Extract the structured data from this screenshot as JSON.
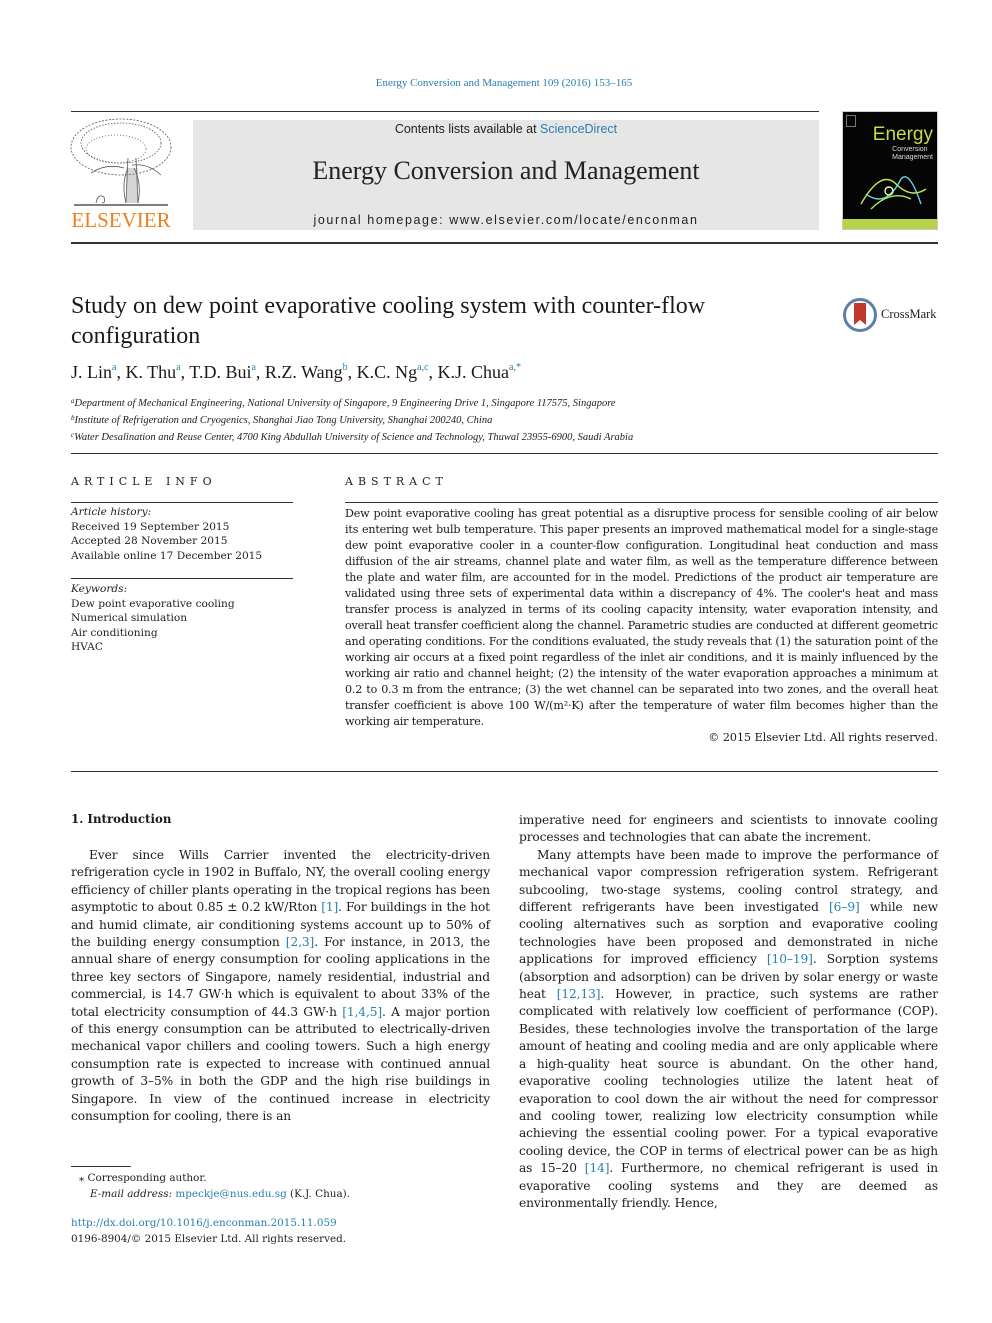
{
  "journal_ref": "Energy Conversion and Management 109 (2016) 153–165",
  "masthead": {
    "contents_prefix": "Contents lists available at ",
    "contents_link": "ScienceDirect",
    "journal_title": "Energy Conversion and Management",
    "homepage": "journal homepage: www.elsevier.com/locate/enconman"
  },
  "publisher_logo": {
    "wordmark": "ELSEVIER",
    "color": "#f07f1a"
  },
  "cover": {
    "title_large": "Energy",
    "title_line2": "Conversion",
    "title_line3": "Management",
    "accent": "#c8d94a"
  },
  "crossmark": {
    "label": "CrossMark"
  },
  "article": {
    "title": "Study on dew point evaporative cooling system with counter-flow configuration",
    "authors": [
      {
        "name": "J. Lin",
        "sup": "a"
      },
      {
        "name": "K. Thu",
        "sup": "a"
      },
      {
        "name": "T.D. Bui",
        "sup": "a"
      },
      {
        "name": "R.Z. Wang",
        "sup": "b"
      },
      {
        "name": "K.C. Ng",
        "sup": "a,c"
      },
      {
        "name": "K.J. Chua",
        "sup": "a,*"
      }
    ],
    "affiliations": [
      {
        "key": "a",
        "text": "Department of Mechanical Engineering, National University of Singapore, 9 Engineering Drive 1, Singapore 117575, Singapore"
      },
      {
        "key": "b",
        "text": "Institute of Refrigeration and Cryogenics, Shanghai Jiao Tong University, Shanghai 200240, China"
      },
      {
        "key": "c",
        "text": "Water Desalination and Reuse Center, 4700 King Abdullah University of Science and Technology, Thuwal 23955-6900, Saudi Arabia"
      }
    ]
  },
  "article_info": {
    "heading": "ARTICLE INFO",
    "history_label": "Article history:",
    "history": [
      "Received 19 September 2015",
      "Accepted 28 November 2015",
      "Available online 17 December 2015"
    ],
    "keywords_label": "Keywords:",
    "keywords": [
      "Dew point evaporative cooling",
      "Numerical simulation",
      "Air conditioning",
      "HVAC"
    ]
  },
  "abstract": {
    "heading": "ABSTRACT",
    "text": "Dew point evaporative cooling has great potential as a disruptive process for sensible cooling of air below its entering wet bulb temperature. This paper presents an improved mathematical model for a single-stage dew point evaporative cooler in a counter-flow configuration. Longitudinal heat conduction and mass diffusion of the air streams, channel plate and water film, as well as the temperature difference between the plate and water film, are accounted for in the model. Predictions of the product air temperature are validated using three sets of experimental data within a discrepancy of 4%. The cooler's heat and mass transfer process is analyzed in terms of its cooling capacity intensity, water evaporation intensity, and overall heat transfer coefficient along the channel. Parametric studies are conducted at different geometric and operating conditions. For the conditions evaluated, the study reveals that (1) the saturation point of the working air occurs at a fixed point regardless of the inlet air conditions, and it is mainly influenced by the working air ratio and channel height; (2) the intensity of the water evaporation approaches a minimum at 0.2 to 0.3 m from the entrance; (3) the wet channel can be separated into two zones, and the overall heat transfer coefficient is above 100 W/(m²·K) after the temperature of water film becomes higher than the working air temperature.",
    "copyright": "© 2015 Elsevier Ltd. All rights reserved."
  },
  "introduction": {
    "heading": "1. Introduction",
    "left_segments": [
      {
        "t": "Ever since Wills Carrier invented the electricity-driven refrigeration cycle in 1902 in Buffalo, NY, the overall cooling energy efficiency of chiller plants operating in the tropical regions has been asymptotic to about 0.85 ± 0.2 kW/Rton "
      },
      {
        "ref": "[1]"
      },
      {
        "t": ". For buildings in the hot and humid climate, air conditioning systems account up to 50% of the building energy consumption "
      },
      {
        "ref": "[2,3]"
      },
      {
        "t": ". For instance, in 2013, the annual share of energy consumption for cooling applications in the three key sectors of Singapore, namely residential, industrial and commercial, is 14.7 GW·h which is equivalent to about 33% of the total electricity consumption of 44.3 GW·h "
      },
      {
        "ref": "[1,4,5]"
      },
      {
        "t": ". A major portion of this energy consumption can be attributed to electrically-driven mechanical vapor chillers and cooling towers. Such a high energy consumption rate is expected to increase with continued annual growth of 3–5% in both the GDP and the high rise buildings in Singapore. In view of the continued increase in electricity consumption for cooling, there is an"
      }
    ],
    "right_p1": "imperative need for engineers and scientists to innovate cooling processes and technologies that can abate the increment.",
    "right_p2_segments": [
      {
        "t": "Many attempts have been made to improve the performance of mechanical vapor compression refrigeration system. Refrigerant subcooling, two-stage systems, cooling control strategy, and different refrigerants have been investigated "
      },
      {
        "ref": "[6–9]"
      },
      {
        "t": " while new cooling alternatives such as sorption and evaporative cooling technologies have been proposed and demonstrated in niche applications for improved efficiency "
      },
      {
        "ref": "[10–19]"
      },
      {
        "t": ". Sorption systems (absorption and adsorption) can be driven by solar energy or waste heat "
      },
      {
        "ref": "[12,13]"
      },
      {
        "t": ". However, in practice, such systems are rather complicated with relatively low coefficient of performance (COP). Besides, these technologies involve the transportation of the large amount of heating and cooling media and are only applicable where a high-quality heat source is abundant. On the other hand, evaporative cooling technologies utilize the latent heat of evaporation to cool down the air without the need for compressor and cooling tower, realizing low electricity consumption while achieving the essential cooling power. For a typical evaporative cooling device, the COP in terms of electrical power can be as high as 15–20 "
      },
      {
        "ref": "[14]"
      },
      {
        "t": ". Furthermore, no chemical refrigerant is used in evaporative cooling systems and they are deemed as environmentally friendly. Hence,"
      }
    ]
  },
  "footnote": {
    "marker": "⁎",
    "corresponding": "Corresponding author.",
    "email_label": "E-mail address:",
    "email": "mpeckje@nus.edu.sg",
    "email_suffix": " (K.J. Chua)."
  },
  "doi": {
    "link": "http://dx.doi.org/10.1016/j.enconman.2015.11.059",
    "issn_line": "0196-8904/© 2015 Elsevier Ltd. All rights reserved."
  },
  "colors": {
    "link": "#2a7fb0",
    "masthead_bg": "#e6e6e6",
    "elsevier_orange": "#f07f1a"
  }
}
